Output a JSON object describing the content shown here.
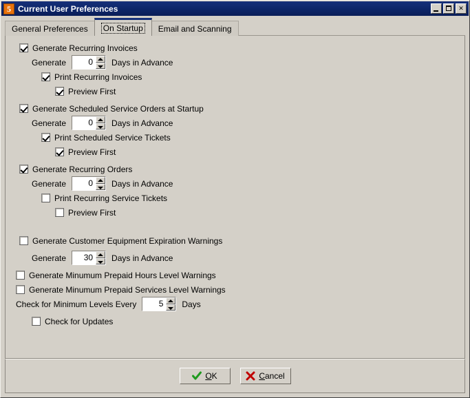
{
  "window": {
    "title": "Current User Preferences",
    "icon": "app-5-icon",
    "controls": {
      "minimize": "minimize-button",
      "maximize": "maximize-button",
      "close_label": "✕"
    },
    "colors": {
      "titlebar": "#0d2568",
      "face": "#d4d0c8",
      "icon_orange": "#e8720c",
      "tab_active_accent": "#16307a",
      "ok_check": "#1f9a1f",
      "cancel_x": "#c00000"
    }
  },
  "tabs": [
    {
      "label": "General Preferences",
      "active": false
    },
    {
      "label": "On Startup",
      "active": true
    },
    {
      "label": "Email and Scanning",
      "active": false
    }
  ],
  "options": {
    "recurring_invoices": {
      "label": "Generate Recurring Invoices",
      "checked": true,
      "generate_label": "Generate",
      "days_value": "0",
      "days_label": "Days in Advance",
      "print_label": "Print Recurring Invoices",
      "print_checked": true,
      "preview_label": "Preview First",
      "preview_checked": true
    },
    "scheduled_service_orders": {
      "label": "Generate Scheduled Service Orders at Startup",
      "checked": true,
      "generate_label": "Generate",
      "days_value": "0",
      "days_label": "Days in Advance",
      "print_label": "Print Scheduled Service Tickets",
      "print_checked": true,
      "preview_label": "Preview First",
      "preview_checked": true
    },
    "recurring_orders": {
      "label": "Generate Recurring Orders",
      "checked": true,
      "generate_label": "Generate",
      "days_value": "0",
      "days_label": "Days in Advance",
      "print_label": "Print Recurring Service Tickets",
      "print_checked": false,
      "preview_label": "Preview First",
      "preview_checked": false
    },
    "equipment_expiration": {
      "label": "Generate Customer Equipment Expiration Warnings",
      "checked": false,
      "generate_label": "Generate",
      "days_value": "30",
      "days_label": "Days in Advance"
    },
    "prepaid_hours": {
      "label": "Generate Minumum Prepaid Hours Level Warnings",
      "checked": false
    },
    "prepaid_services": {
      "label": "Generate Minumum Prepaid Services Level Warnings",
      "checked": false
    },
    "minimum_levels": {
      "label": "Check for Minimum Levels Every",
      "value": "5",
      "unit_label": "Days"
    },
    "check_updates": {
      "label": "Check for Updates",
      "checked": false
    }
  },
  "footer": {
    "ok_label": "OK",
    "ok_accel": "O",
    "ok_rest": "K",
    "cancel_label": "Cancel",
    "cancel_accel": "C",
    "cancel_rest": "ancel"
  }
}
